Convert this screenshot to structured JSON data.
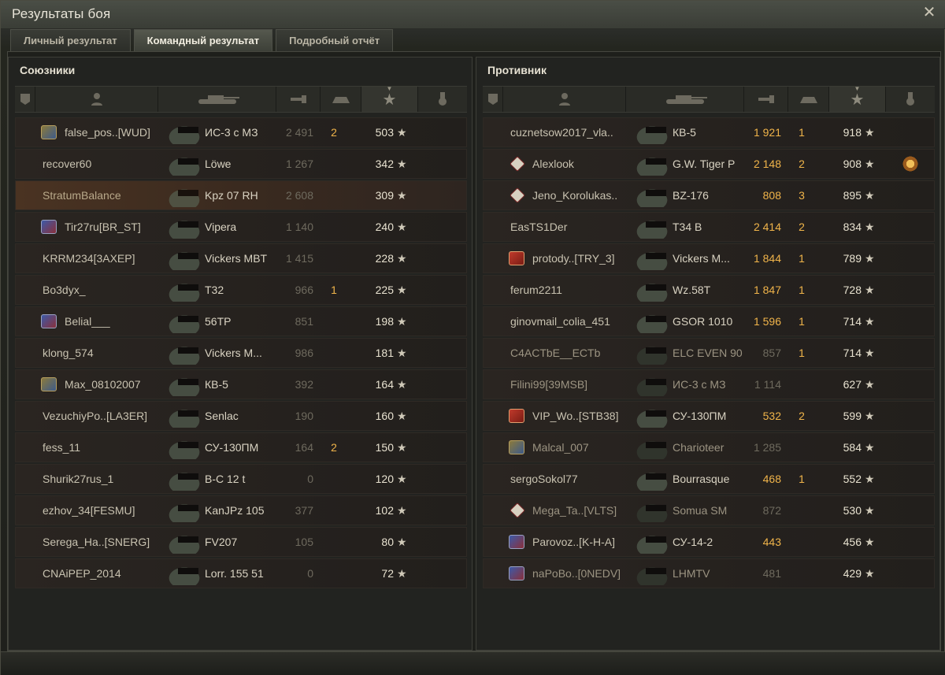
{
  "window": {
    "title": "Результаты боя"
  },
  "tabs": [
    {
      "label": "Личный результат",
      "active": false
    },
    {
      "label": "Командный результат",
      "active": true
    },
    {
      "label": "Подробный отчёт",
      "active": false
    }
  ],
  "allies": {
    "title": "Союзники",
    "rows": [
      {
        "player": "false_pos..[WUD]",
        "badge": "clan-gold",
        "tank": "ИС-3 с МЗ",
        "damage": "2 491",
        "kills": "2",
        "xp": "503",
        "highlight": false
      },
      {
        "player": "recover60",
        "badge": "",
        "tank": "Löwe",
        "damage": "1 267",
        "kills": "",
        "xp": "342",
        "highlight": false
      },
      {
        "player": "StratumBalance",
        "badge": "",
        "tank": "Kpz 07 RH",
        "damage": "2 608",
        "kills": "",
        "xp": "309",
        "highlight": true
      },
      {
        "player": "Tir27ru[BR_ST]",
        "badge": "clan",
        "tank": "Vipera",
        "damage": "1 140",
        "kills": "",
        "xp": "240",
        "highlight": false
      },
      {
        "player": "KRRM234[3AXEP]",
        "badge": "",
        "tank": "Vickers MBT",
        "damage": "1 415",
        "kills": "",
        "xp": "228",
        "highlight": false
      },
      {
        "player": "Bo3dyx_",
        "badge": "",
        "tank": "T32",
        "damage": "966",
        "kills": "1",
        "xp": "225",
        "highlight": false
      },
      {
        "player": "Belial___",
        "badge": "clan",
        "tank": "56TP",
        "damage": "851",
        "kills": "",
        "xp": "198",
        "highlight": false
      },
      {
        "player": "klong_574",
        "badge": "",
        "tank": "Vickers M...",
        "damage": "986",
        "kills": "",
        "xp": "181",
        "highlight": false
      },
      {
        "player": "Max_08102007",
        "badge": "clan-gold",
        "tank": "КВ-5",
        "damage": "392",
        "kills": "",
        "xp": "164",
        "highlight": false
      },
      {
        "player": "VezuchiyPo..[LA3ER]",
        "badge": "",
        "tank": "Senlac",
        "damage": "190",
        "kills": "",
        "xp": "160",
        "highlight": false
      },
      {
        "player": "fess_11",
        "badge": "",
        "tank": "СУ-130ПМ",
        "damage": "164",
        "kills": "2",
        "xp": "150",
        "highlight": false
      },
      {
        "player": "Shurik27rus_1",
        "badge": "",
        "tank": "B-C 12 t",
        "damage": "0",
        "kills": "",
        "xp": "120",
        "highlight": false
      },
      {
        "player": "ezhov_34[FESMU]",
        "badge": "",
        "tank": "KanJPz 105",
        "damage": "377",
        "kills": "",
        "xp": "102",
        "highlight": false
      },
      {
        "player": "Serega_Ha..[SNERG]",
        "badge": "",
        "tank": "FV207",
        "damage": "105",
        "kills": "",
        "xp": "80",
        "highlight": false
      },
      {
        "player": "CNAiPEP_2014",
        "badge": "",
        "tank": "Lorr. 155 51",
        "damage": "0",
        "kills": "",
        "xp": "72",
        "highlight": false
      }
    ]
  },
  "enemies": {
    "title": "Противник",
    "rows": [
      {
        "player": "cuznetsow2017_vla..",
        "badge": "",
        "tank": "КВ-5",
        "damage": "1 921",
        "kills": "1",
        "xp": "918",
        "medal": false,
        "alive": true
      },
      {
        "player": "Alexlook",
        "badge": "diamond",
        "tank": "G.W. Tiger P",
        "damage": "2 148",
        "kills": "2",
        "xp": "908",
        "medal": true,
        "alive": true
      },
      {
        "player": "Jeno_Korolukas..",
        "badge": "diamond",
        "tank": "BZ-176",
        "damage": "808",
        "kills": "3",
        "xp": "895",
        "medal": false,
        "alive": true
      },
      {
        "player": "EasTS1Der",
        "badge": "",
        "tank": "T34 B",
        "damage": "2 414",
        "kills": "2",
        "xp": "834",
        "medal": false,
        "alive": true
      },
      {
        "player": "protody..[TRY_3]",
        "badge": "clan-red",
        "tank": "Vickers M...",
        "damage": "1 844",
        "kills": "1",
        "xp": "789",
        "medal": false,
        "alive": true
      },
      {
        "player": "ferum2211",
        "badge": "",
        "tank": "Wz.58T",
        "damage": "1 847",
        "kills": "1",
        "xp": "728",
        "medal": false,
        "alive": true
      },
      {
        "player": "ginovmail_colia_451",
        "badge": "",
        "tank": "GSOR 1010",
        "damage": "1 596",
        "kills": "1",
        "xp": "714",
        "medal": false,
        "alive": true
      },
      {
        "player": "C4ACTbE__ECTb",
        "badge": "",
        "tank": "ELC EVEN 90",
        "damage": "857",
        "kills": "1",
        "xp": "714",
        "medal": false,
        "alive": false
      },
      {
        "player": "Filini99[39MSB]",
        "badge": "",
        "tank": "ИС-3 с МЗ",
        "damage": "1 114",
        "kills": "",
        "xp": "627",
        "medal": false,
        "alive": false
      },
      {
        "player": "VIP_Wo..[STB38]",
        "badge": "clan-red",
        "tank": "СУ-130ПМ",
        "damage": "532",
        "kills": "2",
        "xp": "599",
        "medal": false,
        "alive": true
      },
      {
        "player": "Malcal_007",
        "badge": "clan-gold",
        "tank": "Charioteer",
        "damage": "1 285",
        "kills": "",
        "xp": "584",
        "medal": false,
        "alive": false
      },
      {
        "player": "sergoSokol77",
        "badge": "",
        "tank": "Bourrasque",
        "damage": "468",
        "kills": "1",
        "xp": "552",
        "medal": false,
        "alive": true
      },
      {
        "player": "Mega_Ta..[VLTS]",
        "badge": "diamond",
        "tank": "Somua SM",
        "damage": "872",
        "kills": "",
        "xp": "530",
        "medal": false,
        "alive": false
      },
      {
        "player": "Parovoz..[K-H-A]",
        "badge": "clan",
        "tank": "СУ-14-2",
        "damage": "443",
        "kills": "",
        "xp": "456",
        "medal": false,
        "alive": true
      },
      {
        "player": "naPoBo..[0NEDV]",
        "badge": "clan",
        "tank": "LHMTV",
        "damage": "481",
        "kills": "",
        "xp": "429",
        "medal": false,
        "alive": false
      }
    ]
  }
}
